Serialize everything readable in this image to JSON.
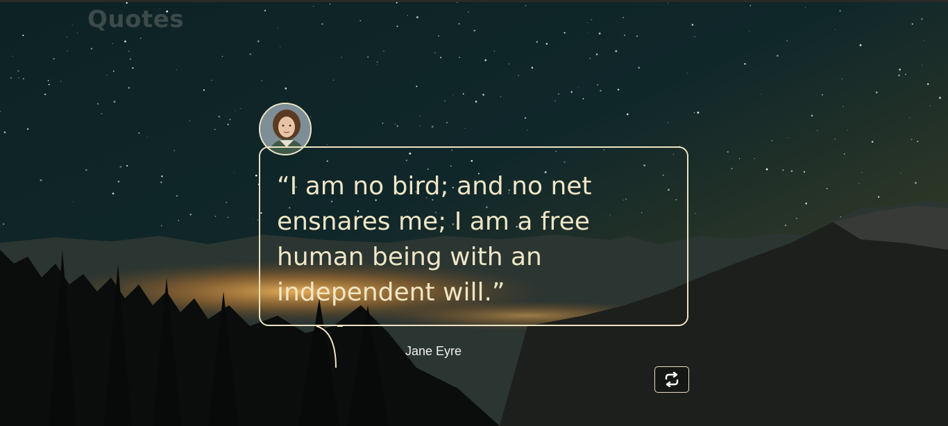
{
  "header": {
    "title": "Quotes"
  },
  "quote": {
    "text": "“I am no bird; and no net ensnares me; I am a free human being with an independent will.”",
    "author": "Jane Eyre"
  },
  "icons": {
    "refresh": "refresh-icon",
    "avatar": "author-portrait"
  },
  "colors": {
    "accent": "#efe6c6",
    "sky_top": "#0c1f22",
    "sky_horizon": "#4a4a28"
  }
}
